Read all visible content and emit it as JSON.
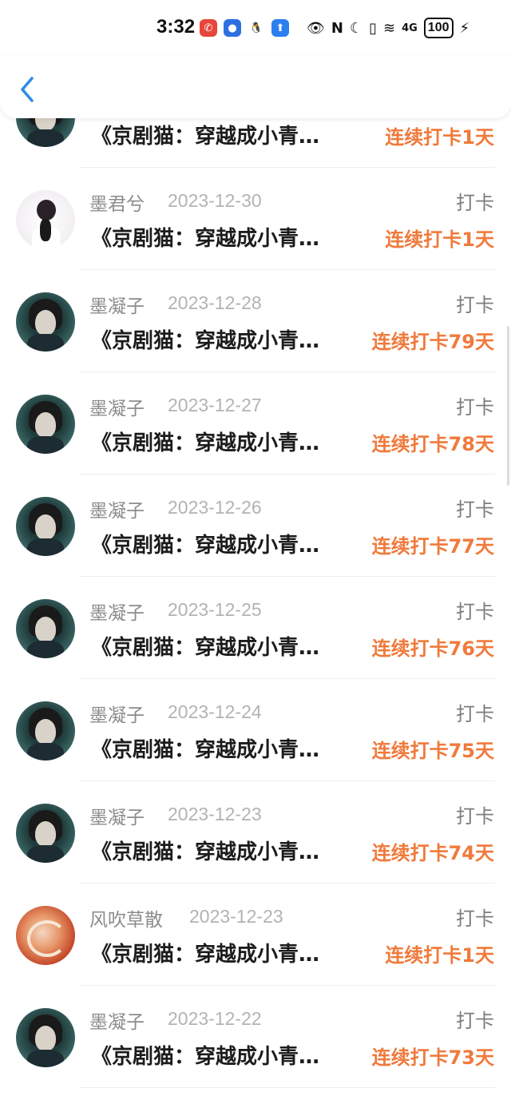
{
  "status_bar": {
    "time": "3:32",
    "battery": "100",
    "network": "4G"
  },
  "header": {
    "back_icon": "chevron-left-icon",
    "accent_color": "#2e8ae6"
  },
  "list": {
    "checkin_label": "打卡",
    "title_text": "《京剧猫：穿越成小青…",
    "streak_color": "#f07a3c",
    "items": [
      {
        "name": "",
        "date": "",
        "title": "《京剧猫：穿越成小青…",
        "streak": "连续打卡1天",
        "avatar": "cat"
      },
      {
        "name": "墨君兮",
        "date": "2023-12-30",
        "title": "《京剧猫：穿越成小青…",
        "streak": "连续打卡1天",
        "avatar": "girl"
      },
      {
        "name": "墨凝子",
        "date": "2023-12-28",
        "title": "《京剧猫：穿越成小青…",
        "streak": "连续打卡79天",
        "avatar": "cat"
      },
      {
        "name": "墨凝子",
        "date": "2023-12-27",
        "title": "《京剧猫：穿越成小青…",
        "streak": "连续打卡78天",
        "avatar": "cat"
      },
      {
        "name": "墨凝子",
        "date": "2023-12-26",
        "title": "《京剧猫：穿越成小青…",
        "streak": "连续打卡77天",
        "avatar": "cat"
      },
      {
        "name": "墨凝子",
        "date": "2023-12-25",
        "title": "《京剧猫：穿越成小青…",
        "streak": "连续打卡76天",
        "avatar": "cat"
      },
      {
        "name": "墨凝子",
        "date": "2023-12-24",
        "title": "《京剧猫：穿越成小青…",
        "streak": "连续打卡75天",
        "avatar": "cat"
      },
      {
        "name": "墨凝子",
        "date": "2023-12-23",
        "title": "《京剧猫：穿越成小青…",
        "streak": "连续打卡74天",
        "avatar": "cat"
      },
      {
        "name": "风吹草散",
        "date": "2023-12-23",
        "title": "《京剧猫：穿越成小青…",
        "streak": "连续打卡1天",
        "avatar": "red"
      },
      {
        "name": "墨凝子",
        "date": "2023-12-22",
        "title": "《京剧猫：穿越成小青…",
        "streak": "连续打卡73天",
        "avatar": "cat"
      }
    ]
  }
}
